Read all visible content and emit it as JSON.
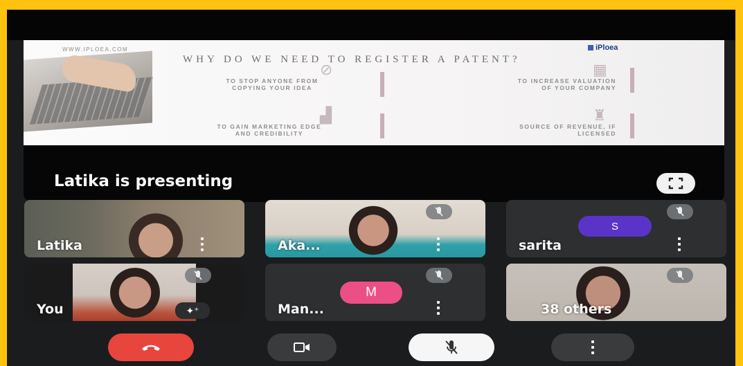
{
  "presentation": {
    "slide": {
      "website": "WWW.IPLOEA.COM",
      "logo": "iPloea",
      "title": "WHY DO WE NEED TO REGISTER A PATENT?",
      "items": [
        {
          "line1": "TO STOP ANYONE FROM",
          "line2": "COPYING YOUR IDEA"
        },
        {
          "line1": "TO INCREASE VALUATION",
          "line2": "OF YOUR COMPANY"
        },
        {
          "line1": "TO GAIN MARKETING EDGE",
          "line2": "AND CREDIBILITY"
        },
        {
          "line1": "SOURCE OF REVENUE, IF",
          "line2": "LICENSED"
        }
      ]
    },
    "presenting_label": "Latika is presenting",
    "fullscreen_icon": "fullscreen-icon"
  },
  "participants": [
    {
      "name": "Latika",
      "muted": false,
      "type": "video"
    },
    {
      "name": "Aka...",
      "muted": true,
      "type": "video"
    },
    {
      "name": "sarita",
      "muted": true,
      "type": "avatar",
      "initial": "S"
    },
    {
      "name": "You",
      "muted": true,
      "type": "video"
    },
    {
      "name": "Man...",
      "muted": true,
      "type": "avatar",
      "initial": "M"
    },
    {
      "name": "38 others",
      "muted": true,
      "type": "video"
    }
  ],
  "controls": {
    "end_call_icon": "phone-hangup-icon",
    "camera_icon": "camera-icon",
    "mic_icon": "mic-off-icon",
    "more_icon": "more-vertical-icon"
  },
  "colors": {
    "frame": "#ffc20e",
    "end_call": "#e8453c",
    "avatar_s": "#5a34c8",
    "avatar_m": "#eb4f86"
  }
}
